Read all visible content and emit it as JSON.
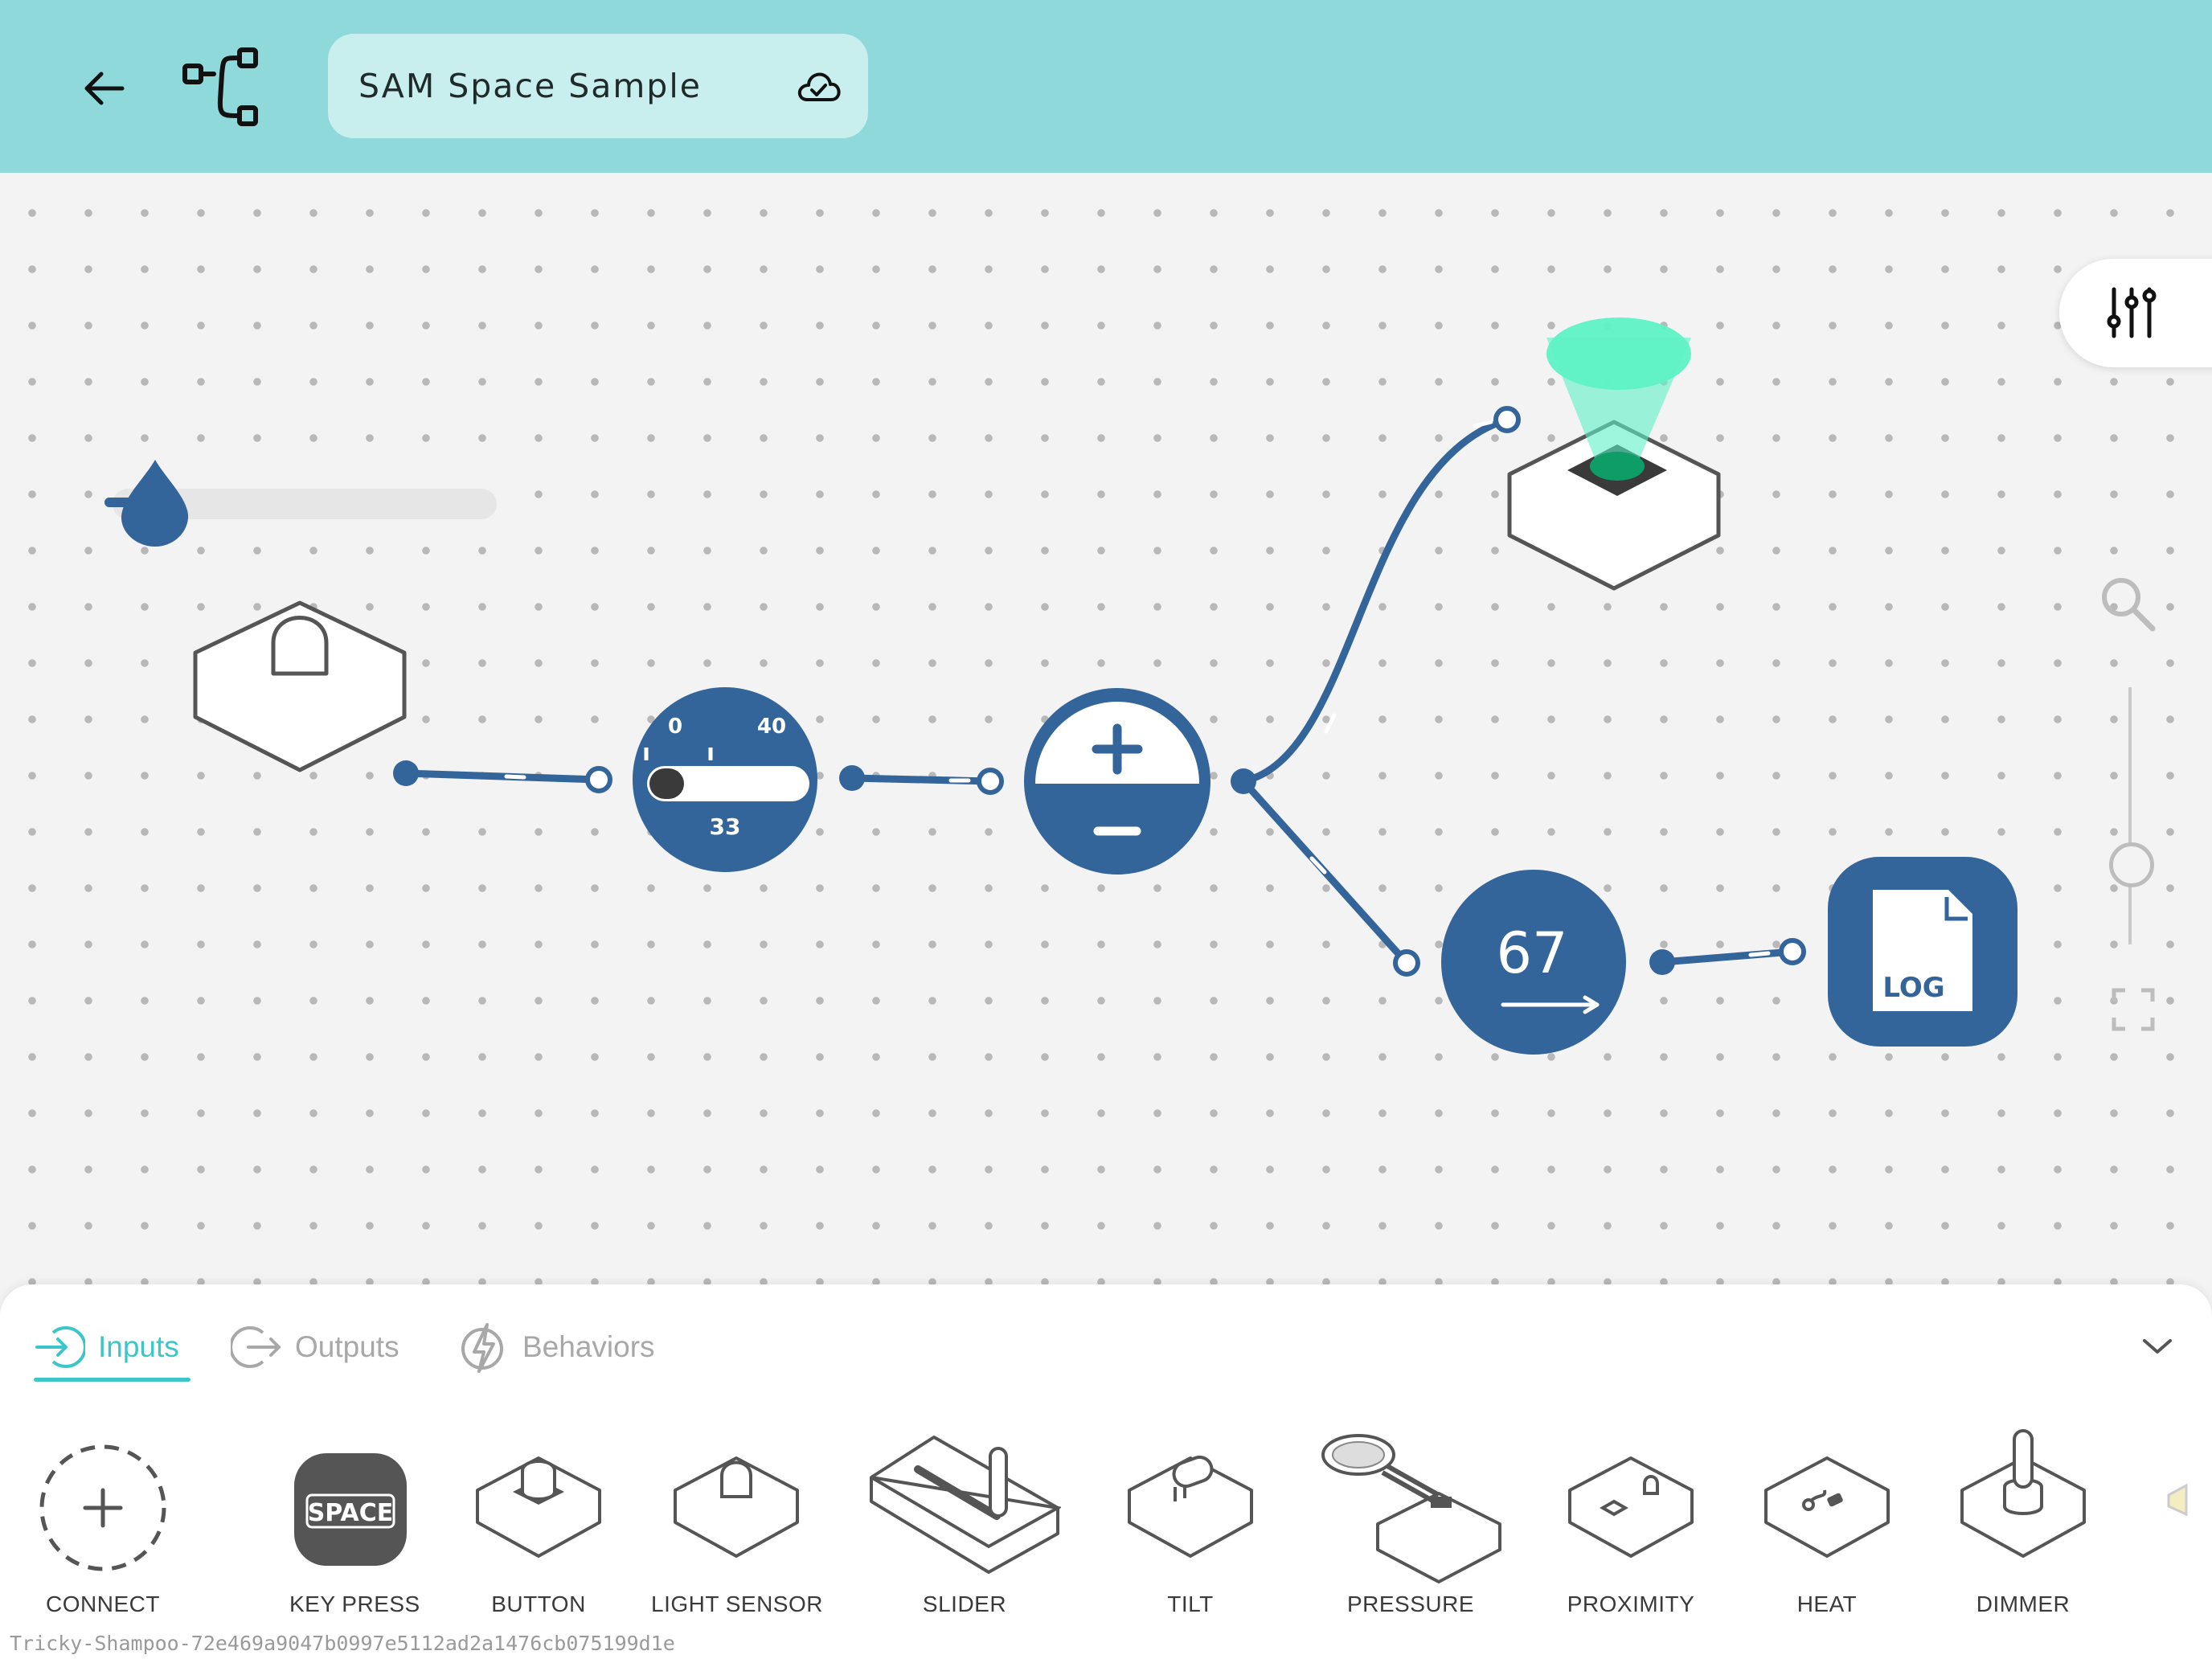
{
  "header": {
    "title": "SAM Space Sample",
    "icons": [
      "back-arrow-icon",
      "flow-graph-icon",
      "cloud-check-icon"
    ],
    "background": "#8fd9da"
  },
  "canvas": {
    "nodes": {
      "slider_node": {
        "min_label": "0",
        "max_label": "40",
        "value": "33",
        "fill_fraction": 0.22
      },
      "counter_node": {
        "value": "67"
      },
      "log_node": {
        "label": "LOG"
      }
    },
    "accent_color": "#34659a",
    "led_color": "#5ef2c4"
  },
  "panel": {
    "tabs": [
      {
        "label": "Inputs",
        "active": true
      },
      {
        "label": "Outputs",
        "active": false
      },
      {
        "label": "Behaviors",
        "active": false
      }
    ],
    "items": [
      {
        "label": "CONNECT"
      },
      {
        "label": "KEY PRESS",
        "key_text": "SPACE"
      },
      {
        "label": "BUTTON"
      },
      {
        "label": "LIGHT SENSOR"
      },
      {
        "label": "SLIDER"
      },
      {
        "label": "TILT"
      },
      {
        "label": "PRESSURE"
      },
      {
        "label": "PROXIMITY"
      },
      {
        "label": "HEAT"
      },
      {
        "label": "DIMMER"
      }
    ],
    "active_color": "#3cc6c9"
  },
  "footer": {
    "id": "Tricky-Shampoo-72e469a9047b0997e5112ad2a1476cb075199d1e"
  }
}
